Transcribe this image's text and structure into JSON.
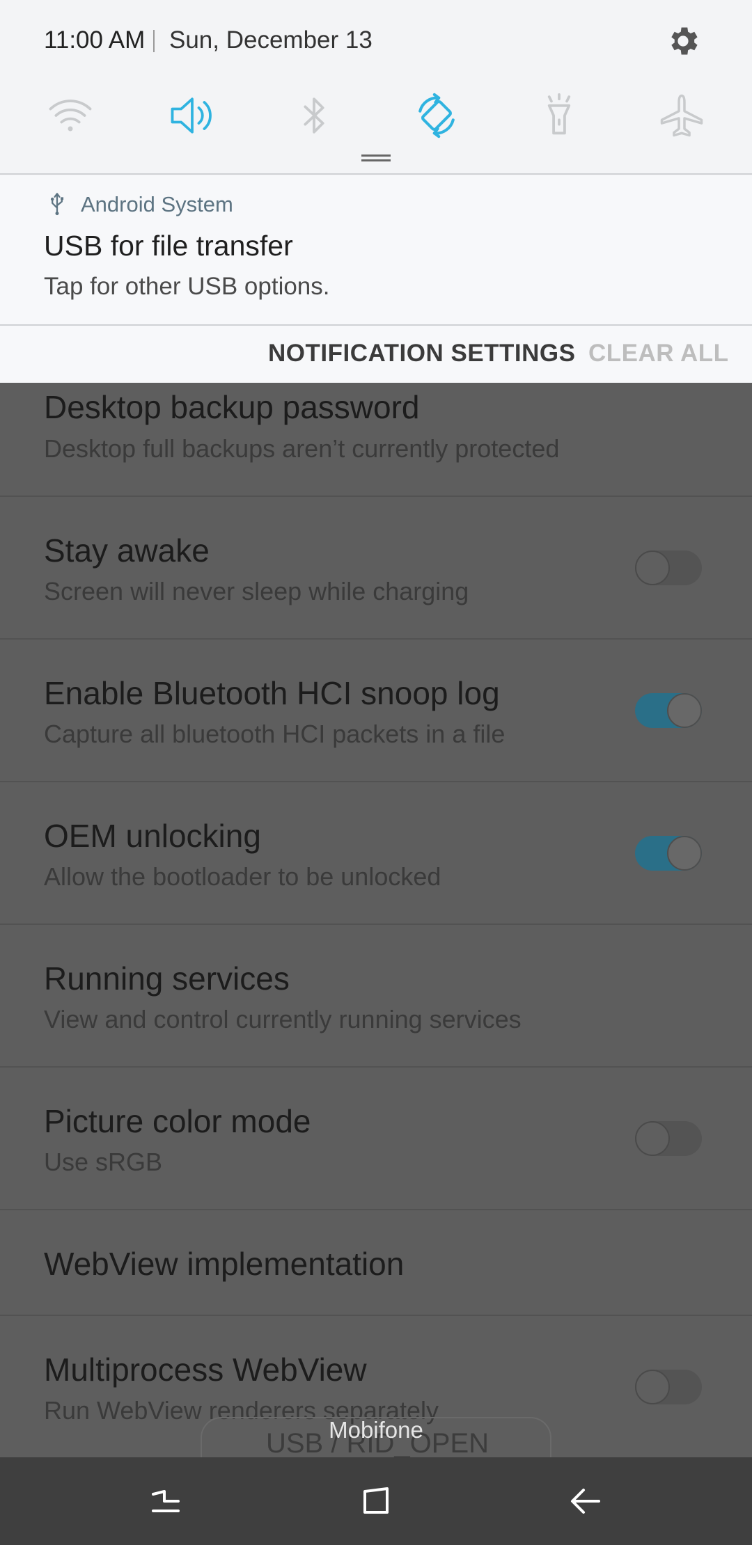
{
  "status": {
    "time": "11:00 AM",
    "date": "Sun, December 13"
  },
  "quick_settings": [
    {
      "icon": "wifi-icon",
      "active": false
    },
    {
      "icon": "sound-icon",
      "active": true
    },
    {
      "icon": "bluetooth-icon",
      "active": false
    },
    {
      "icon": "auto-rotate-icon",
      "active": true
    },
    {
      "icon": "flashlight-icon",
      "active": false
    },
    {
      "icon": "airplane-mode-icon",
      "active": false
    }
  ],
  "notification": {
    "app_name": "Android System",
    "title": "USB for file transfer",
    "text": "Tap for other USB options."
  },
  "actions": {
    "settings_label": "NOTIFICATION SETTINGS",
    "clear_label": "CLEAR ALL"
  },
  "settings": [
    {
      "title": "Desktop backup password",
      "summary": "Desktop full backups aren’t currently protected"
    },
    {
      "title": "Stay awake",
      "summary": "Screen will never sleep while charging",
      "toggle": false
    },
    {
      "title": "Enable Bluetooth HCI snoop log",
      "summary": "Capture all bluetooth HCI packets in a file",
      "toggle": true
    },
    {
      "title": "OEM unlocking",
      "summary": "Allow the bootloader to be unlocked",
      "toggle": true
    },
    {
      "title": "Running services",
      "summary": "View and control currently running services"
    },
    {
      "title": "Picture color mode",
      "summary": "Use sRGB",
      "toggle": false
    },
    {
      "title": "WebView implementation"
    },
    {
      "title": "Multiprocess WebView",
      "summary": "Run WebView renderers separately",
      "toggle": false
    }
  ],
  "toast_behind": "USB / RID_OPEN",
  "carrier": "Mobifone",
  "colors": {
    "accent": "#2fb3e0",
    "toggle_on": "#2a6f88",
    "shade_bg": "#f3f4f6",
    "scrim_bg": "#5e5e5e"
  }
}
